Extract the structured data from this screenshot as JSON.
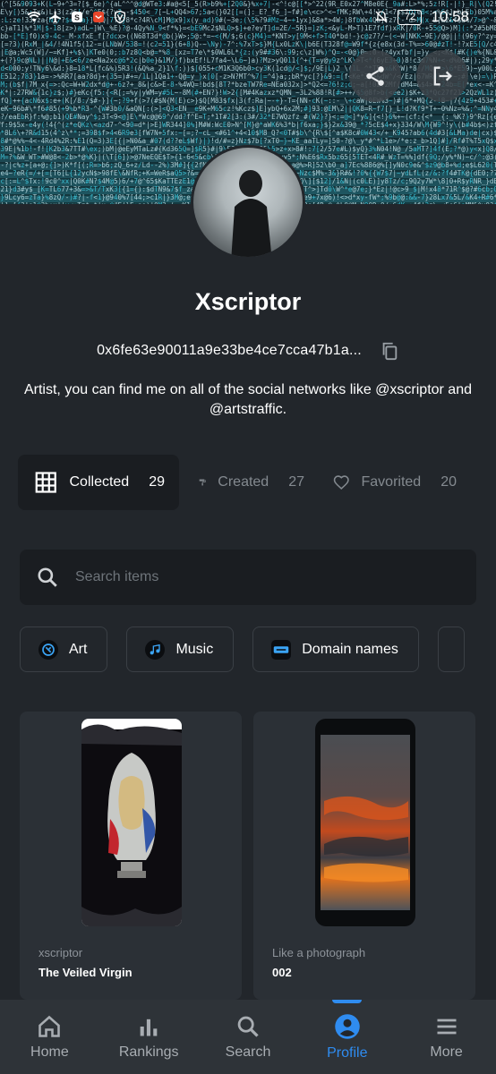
{
  "status_bar": {
    "battery": "72",
    "time": "10:58"
  },
  "profile": {
    "name": "Xscriptor",
    "address": "0x6fe63e90011a9e33be4ce7cca47b1a...",
    "bio": "Artist, you can find me on all of the social networks like @xscriptor and @artstraffic."
  },
  "tabs": [
    {
      "label": "Collected",
      "count": "29",
      "icon": "grid-icon",
      "active": true
    },
    {
      "label": "Created",
      "count": "27",
      "icon": "paint-roller-icon",
      "active": false
    },
    {
      "label": "Favorited",
      "count": "20",
      "icon": "heart-icon",
      "active": false
    }
  ],
  "search": {
    "placeholder": "Search items"
  },
  "categories": [
    {
      "label": "Art",
      "icon": "art-icon"
    },
    {
      "label": "Music",
      "icon": "music-icon"
    },
    {
      "label": "Domain names",
      "icon": "domain-icon"
    }
  ],
  "items": [
    {
      "creator": "xscriptor",
      "title": "The Veiled Virgin"
    },
    {
      "creator": "Like a photograph",
      "title": "002"
    }
  ],
  "nav": [
    {
      "label": "Home",
      "icon": "home-icon",
      "active": false
    },
    {
      "label": "Rankings",
      "icon": "bar-chart-icon",
      "active": false
    },
    {
      "label": "Search",
      "icon": "search-icon",
      "active": false
    },
    {
      "label": "Profile",
      "icon": "profile-icon",
      "active": true
    },
    {
      "label": "More",
      "icon": "menu-icon",
      "active": false
    }
  ],
  "colors": {
    "background": "#22262b",
    "surface": "#1a1d21",
    "card": "#2b3036",
    "accent": "#2f8cf0",
    "muted_text": "#848a90"
  }
}
